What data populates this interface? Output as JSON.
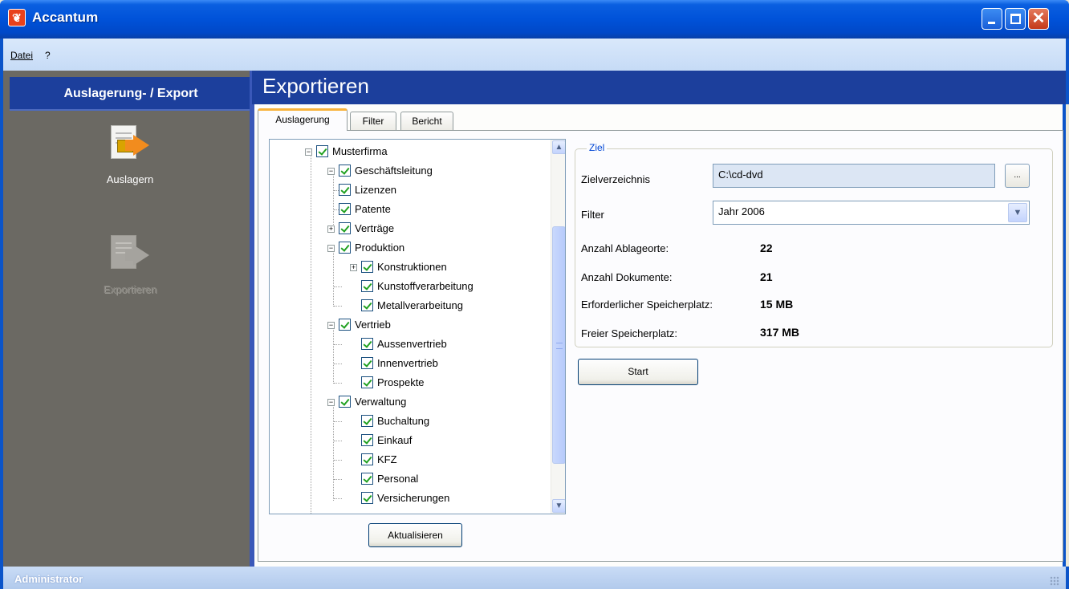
{
  "window": {
    "title": "Accantum",
    "icon": "app-logo-icon",
    "controls": {
      "minimize": "minimize-icon",
      "maximize": "maximize-icon",
      "close": "close-icon"
    },
    "colors": {
      "titlebar": "#0052d9",
      "header": "#1c3f9c",
      "left_panel": "#6b6963",
      "accent": "#f8b33b"
    }
  },
  "menubar": {
    "items": [
      {
        "label": "Datei"
      },
      {
        "label": "?"
      }
    ]
  },
  "sidebar": {
    "header": "Auslagerung- / Export",
    "items": [
      {
        "label": "Auslagern",
        "icon": "auslagern-icon",
        "enabled": true
      },
      {
        "label": "Exportieren",
        "icon": "exportieren-icon",
        "enabled": false
      }
    ]
  },
  "main": {
    "title": "Exportieren",
    "tabs": [
      {
        "label": "Auslagerung",
        "active": true
      },
      {
        "label": "Filter",
        "active": false
      },
      {
        "label": "Bericht",
        "active": false
      }
    ],
    "tree": {
      "nodes": [
        {
          "label": "Musterfirma",
          "checked": true,
          "expander": "−"
        },
        {
          "label": "Geschäftsleitung",
          "checked": true,
          "expander": "−"
        },
        {
          "label": "Lizenzen",
          "checked": true
        },
        {
          "label": "Patente",
          "checked": true
        },
        {
          "label": "Verträge",
          "checked": true,
          "expander": "+"
        },
        {
          "label": "Produktion",
          "checked": true,
          "expander": "−"
        },
        {
          "label": "Konstruktionen",
          "checked": true,
          "expander": "+"
        },
        {
          "label": "Kunstoffverarbeitung",
          "checked": true
        },
        {
          "label": "Metallverarbeitung",
          "checked": true
        },
        {
          "label": "Vertrieb",
          "checked": true,
          "expander": "−"
        },
        {
          "label": "Aussenvertrieb",
          "checked": true
        },
        {
          "label": "Innenvertrieb",
          "checked": true
        },
        {
          "label": "Prospekte",
          "checked": true
        },
        {
          "label": "Verwaltung",
          "checked": true,
          "expander": "−"
        },
        {
          "label": "Buchaltung",
          "checked": true
        },
        {
          "label": "Einkauf",
          "checked": true
        },
        {
          "label": "KFZ",
          "checked": true
        },
        {
          "label": "Personal",
          "checked": true
        },
        {
          "label": "Versicherungen",
          "checked": true
        }
      ],
      "scroll_up": "▲",
      "scroll_down": "▼"
    },
    "refresh_button": "Aktualisieren",
    "group": {
      "title": "Ziel",
      "target_dir_label": "Zielverzeichnis",
      "target_dir_value": "C:\\cd-dvd",
      "browse_label": "...",
      "filter_label": "Filter",
      "filter_value": "Jahr 2006",
      "filter_arrow": "▼",
      "stats": [
        {
          "label": "Anzahl Ablageorte:",
          "value": "22"
        },
        {
          "label": "Anzahl Dokumente:",
          "value": "21"
        },
        {
          "label": "Erforderlicher Speicherplatz:",
          "value": "15 MB"
        },
        {
          "label": "Freier Speicherplatz:",
          "value": "317 MB"
        }
      ]
    },
    "start_button": "Start"
  },
  "statusbar": {
    "text": "Administrator"
  }
}
